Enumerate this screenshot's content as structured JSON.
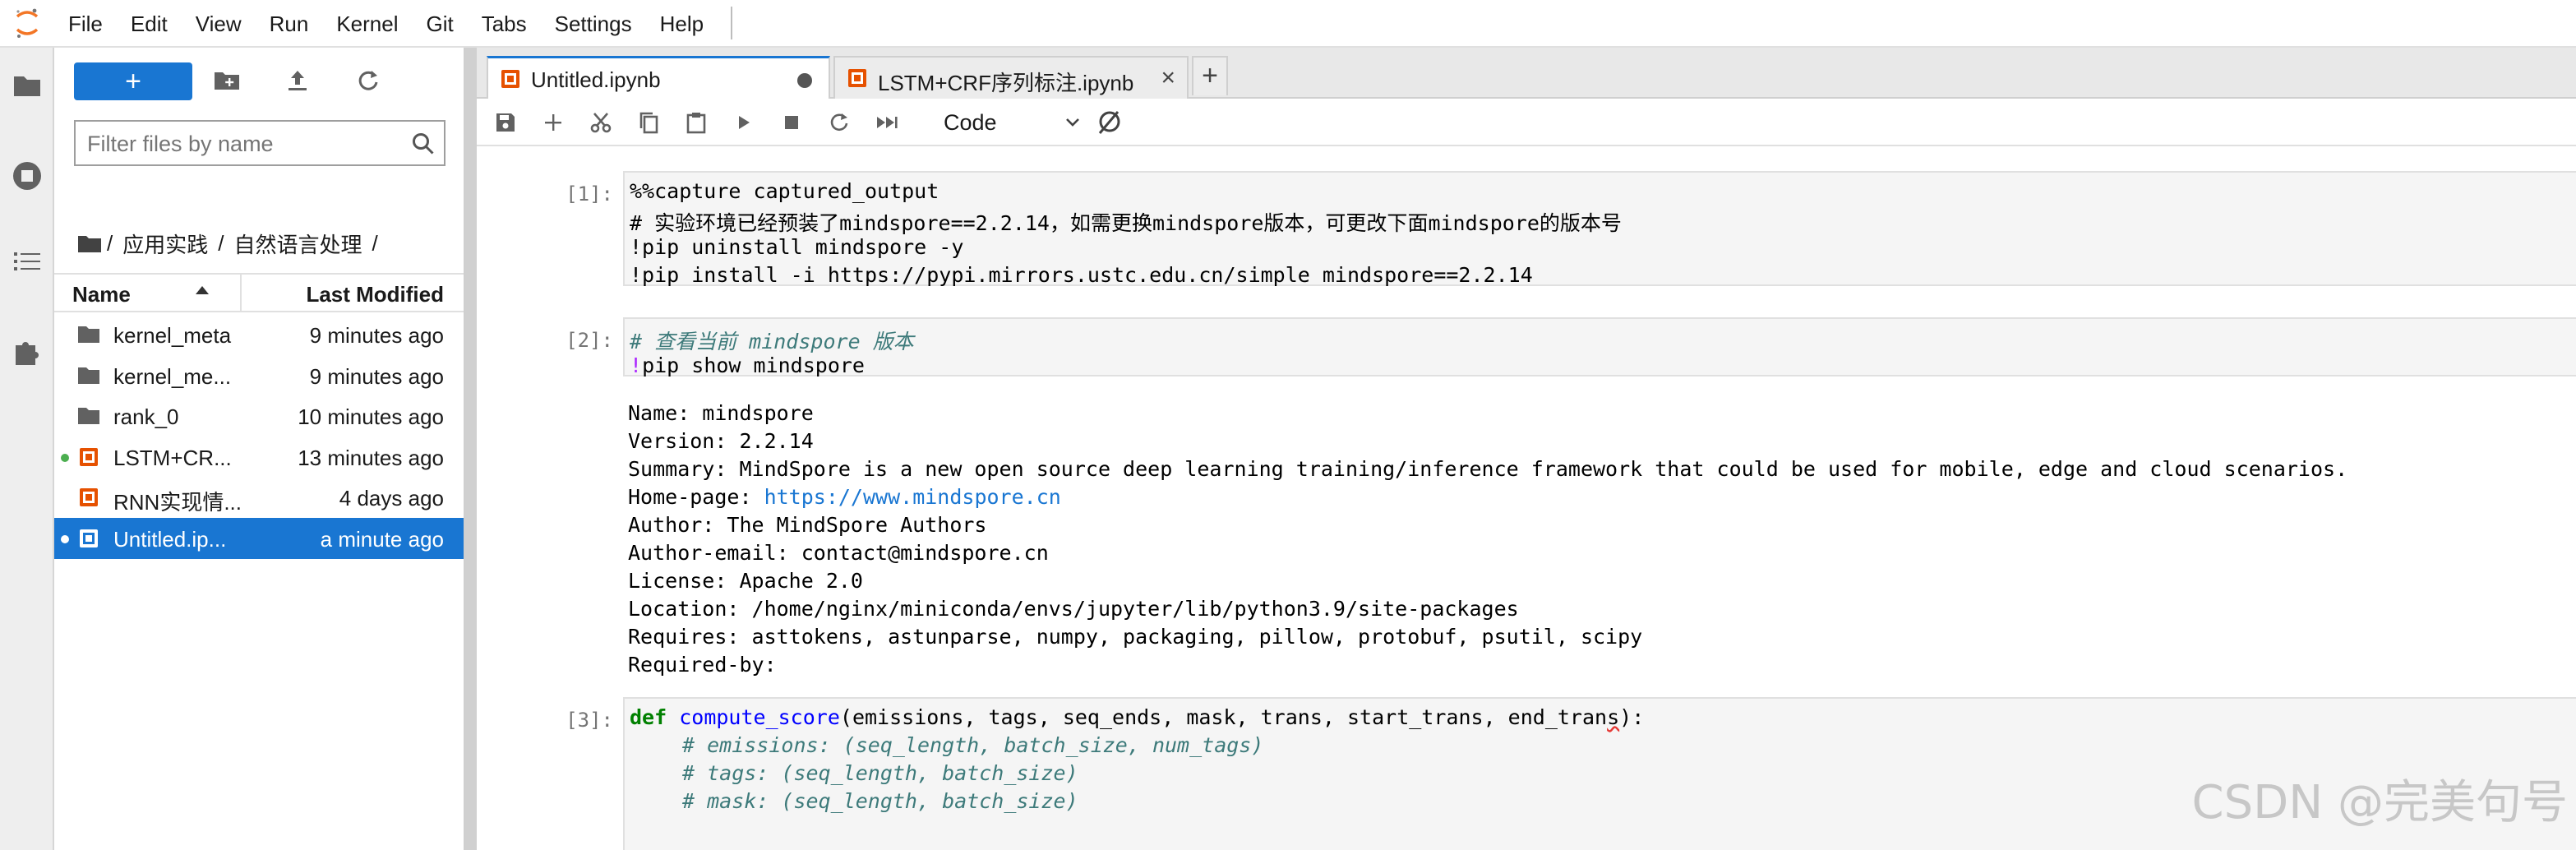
{
  "menu": [
    "File",
    "Edit",
    "View",
    "Run",
    "Kernel",
    "Git",
    "Tabs",
    "Settings",
    "Help"
  ],
  "filebrowser": {
    "new_label": "+",
    "filter_placeholder": "Filter files by name",
    "breadcrumb": [
      "/",
      "应用实践",
      "/",
      "自然语言处理",
      "/"
    ],
    "columns": {
      "name": "Name",
      "modified": "Last Modified"
    },
    "files": [
      {
        "name": "kernel_meta",
        "modified": "9 minutes ago",
        "kind": "folder",
        "running": false,
        "selected": false
      },
      {
        "name": "kernel_me...",
        "modified": "9 minutes ago",
        "kind": "folder",
        "running": false,
        "selected": false
      },
      {
        "name": "rank_0",
        "modified": "10 minutes ago",
        "kind": "folder",
        "running": false,
        "selected": false
      },
      {
        "name": "LSTM+CR...",
        "modified": "13 minutes ago",
        "kind": "notebook",
        "running": true,
        "selected": false
      },
      {
        "name": "RNN实现情...",
        "modified": "4 days ago",
        "kind": "notebook",
        "running": false,
        "selected": false
      },
      {
        "name": "Untitled.ip...",
        "modified": "a minute ago",
        "kind": "notebook",
        "running": true,
        "selected": true
      }
    ]
  },
  "tabs": [
    {
      "label": "Untitled.ipynb",
      "active": true,
      "status": "unsaved"
    },
    {
      "label": "LSTM+CRF序列标注.ipynb",
      "active": false,
      "status": "close"
    }
  ],
  "add_tab_label": "+",
  "toolbar": {
    "cell_type": "Code"
  },
  "cells": {
    "c1": {
      "prompt": "[1]:",
      "lines": [
        "%%capture captured_output",
        "# 实验环境已经预装了mindspore==2.2.14，如需更换mindspore版本，可更改下面mindspore的版本号",
        "!pip uninstall mindspore -y",
        "!pip install -i https://pypi.mirrors.ustc.edu.cn/simple mindspore==2.2.14"
      ]
    },
    "c2": {
      "prompt": "[2]:",
      "comment": "# 查看当前 mindspore 版本",
      "bang": "!",
      "cmd": "pip show mindspore",
      "output": [
        "Name: mindspore",
        "Version: 2.2.14",
        "Summary: MindSpore is a new open source deep learning training/inference framework that could be used for mobile, edge and cloud scenarios.",
        "Author: The MindSpore Authors",
        "Author-email: contact@mindspore.cn",
        "License: Apache 2.0",
        "Location: /home/nginx/miniconda/envs/jupyter/lib/python3.9/site-packages",
        "Requires: asttokens, astunparse, numpy, packaging, pillow, protobuf, psutil, scipy",
        "Required-by:"
      ],
      "homepage_label": "Home-page: ",
      "homepage_url": "https://www.mindspore.cn"
    },
    "c3": {
      "prompt": "[3]:",
      "kw": "def",
      "fn": "compute_score",
      "args": "(emissions, tags, seq_ends, mask, trans, start_trans, end_tran",
      "squig": "s",
      "tail": "):",
      "comments": [
        "# emissions: (seq_length, batch_size, num_tags)",
        "# tags: (seq_length, batch_size)",
        "# mask: (seq_length, batch_size)"
      ]
    }
  },
  "watermark": "CSDN @完美句号",
  "colors": {
    "accent": "#1976d2",
    "running_dot": "#4caf50",
    "notebook_icon": "#e65100"
  }
}
